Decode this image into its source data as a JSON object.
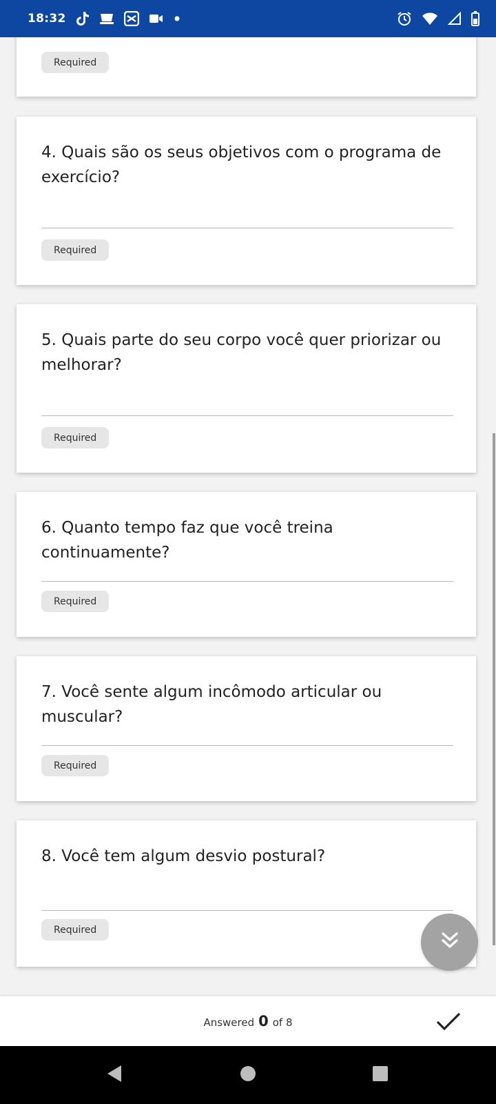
{
  "status_bar": {
    "time": "18:32",
    "left_icons": [
      "tiktok-icon",
      "cup-icon",
      "capcut-icon",
      "video-camera-icon",
      "dot-icon"
    ],
    "right_icons": [
      "alarm-icon",
      "wifi-icon",
      "signal-icon",
      "battery-icon"
    ]
  },
  "questions": [
    {
      "text": "",
      "required_label": "Required"
    },
    {
      "text": "4. Quais são os seus objetivos com o programa de exercício?",
      "required_label": "Required"
    },
    {
      "text": "5. Quais parte do seu corpo você quer priorizar ou melhorar?",
      "required_label": "Required"
    },
    {
      "text": "6. Quanto tempo faz que você treina continuamente?",
      "required_label": "Required"
    },
    {
      "text": "7. Você sente algum incômodo articular ou muscular?",
      "required_label": "Required"
    },
    {
      "text": "8. Você tem algum desvio postural?",
      "required_label": "Required"
    }
  ],
  "fab": {
    "icon": "double-chevron-down-icon"
  },
  "footer": {
    "answered_label": "Answered",
    "answered_count": "0",
    "of_label": "of 8",
    "submit_icon": "checkmark-icon"
  },
  "nav_bar": {
    "icons": [
      "back-icon",
      "home-icon",
      "recents-icon"
    ]
  },
  "colors": {
    "status_bar": "#0d47a1",
    "chip": "#e6e6e6",
    "fab": "#a3a3a3"
  }
}
